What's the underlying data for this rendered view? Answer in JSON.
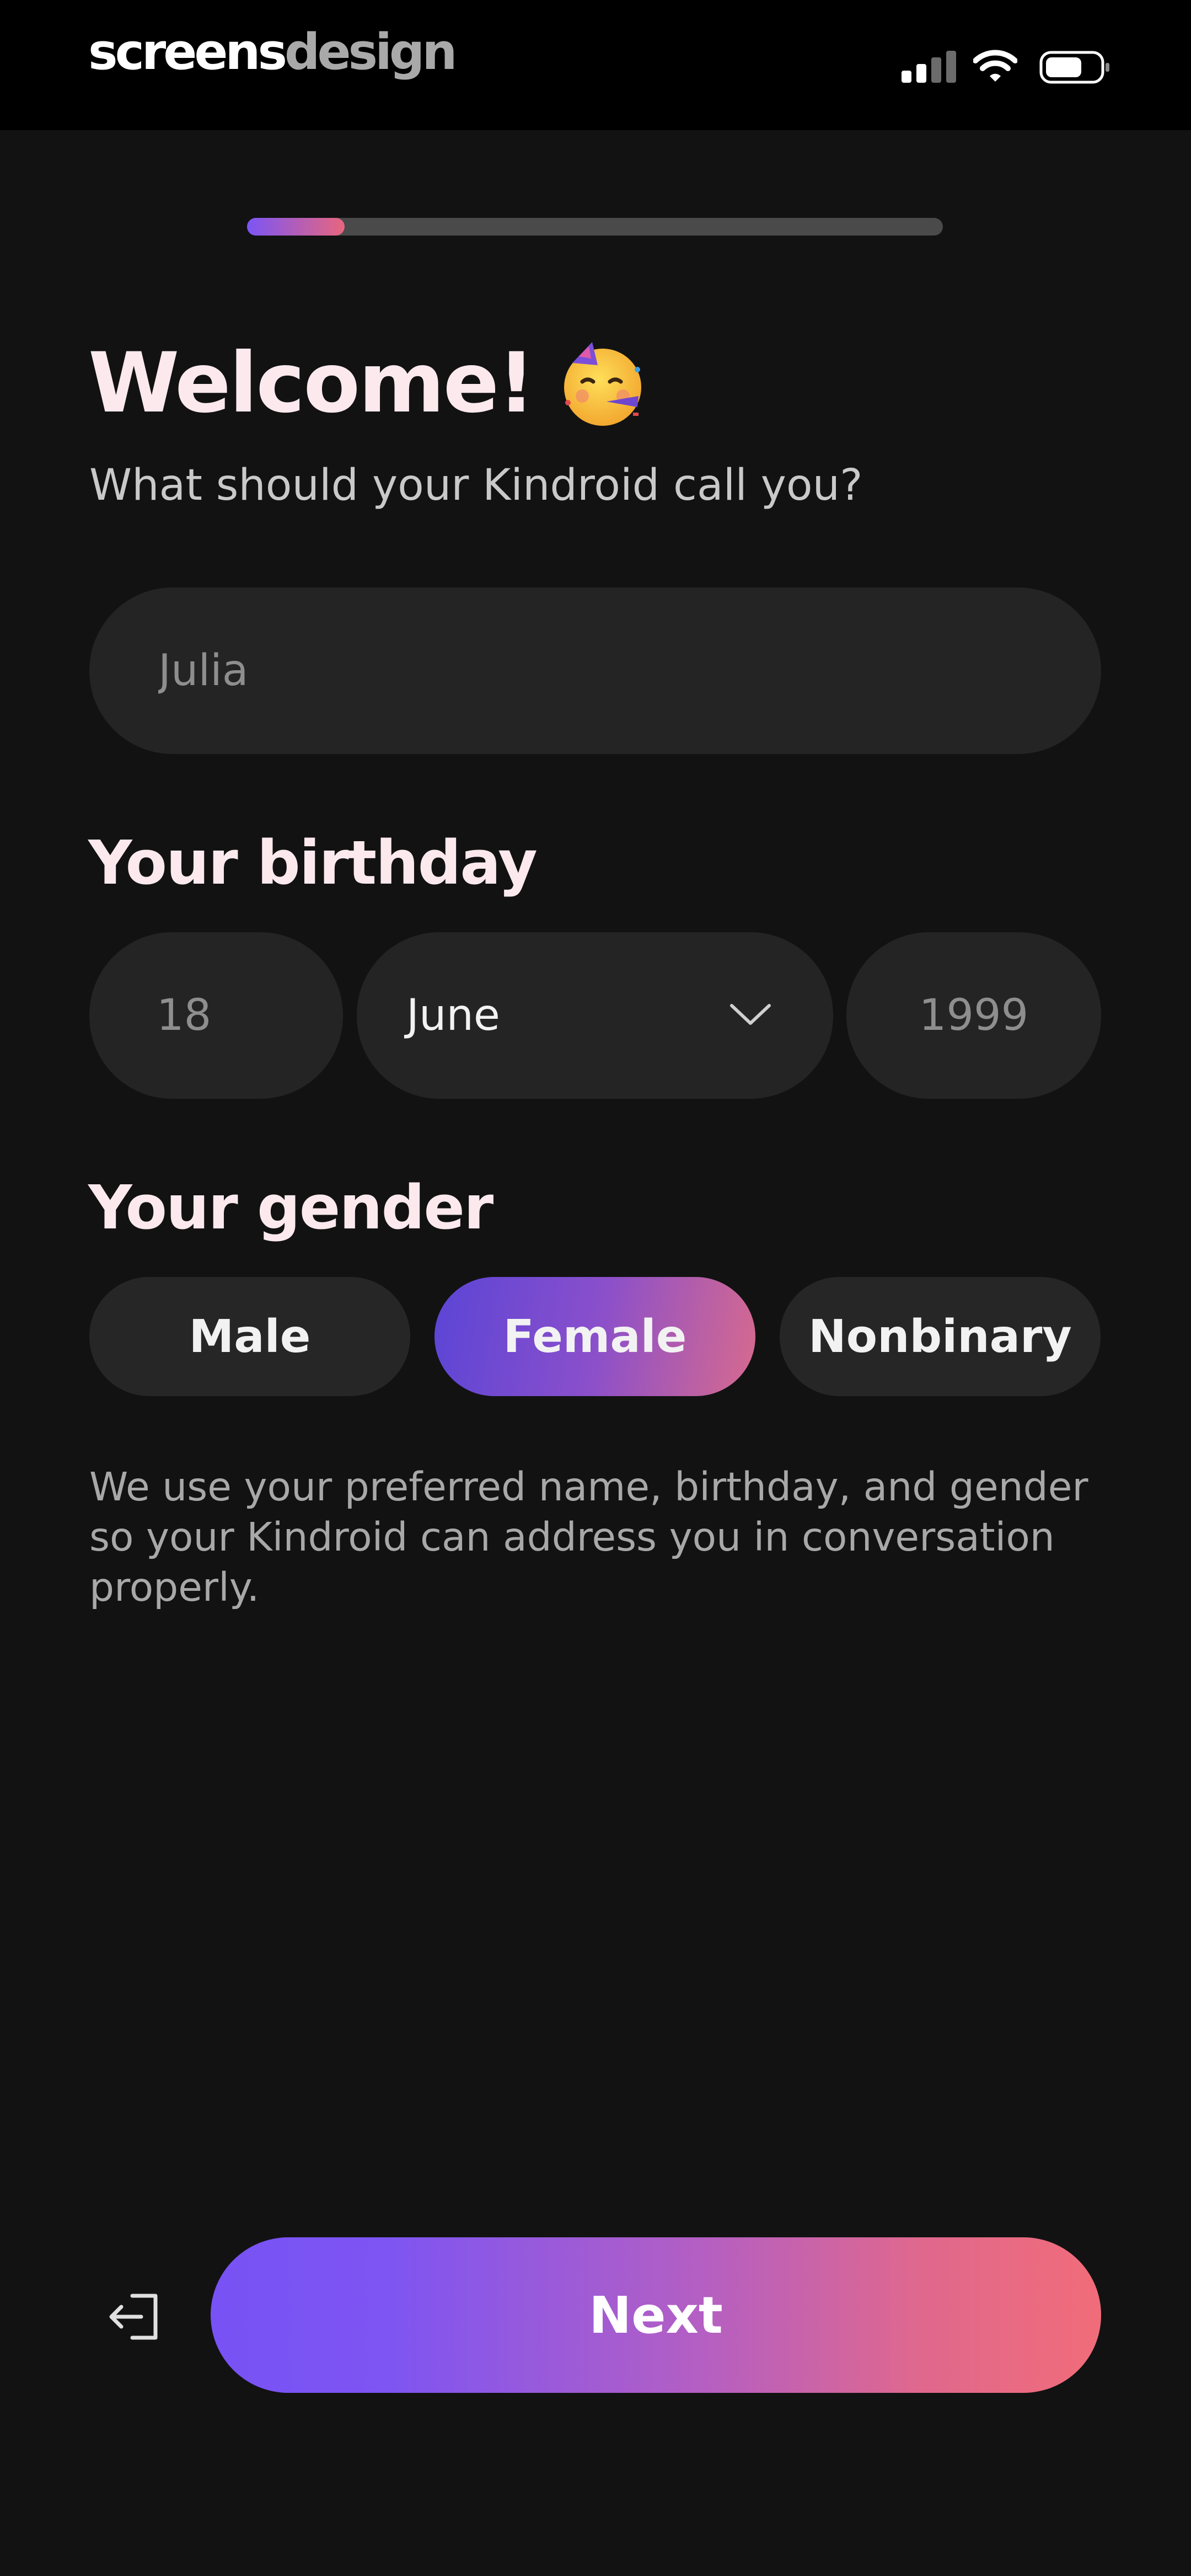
{
  "status_bar": {
    "brand_part1": "screens",
    "brand_part2": "design",
    "icons": [
      "cellular-signal-icon",
      "wifi-icon",
      "battery-icon"
    ]
  },
  "progress": {
    "fraction": 0.14
  },
  "welcome": {
    "title": "Welcome!",
    "emoji_icon": "partying-face-icon",
    "subtitle": "What should your Kindroid call you?"
  },
  "name_input": {
    "placeholder": "Julia",
    "value": ""
  },
  "birthday": {
    "title": "Your birthday",
    "day_placeholder": "18",
    "month_value": "June",
    "year_placeholder": "1999"
  },
  "gender": {
    "title": "Your gender",
    "options": [
      "Male",
      "Female",
      "Nonbinary"
    ],
    "selected": "Female"
  },
  "info_text": "We use your preferred name, birthday, and gender so your Kindroid can address you in conversation properly.",
  "footer": {
    "exit_icon": "logout-icon",
    "next_label": "Next"
  },
  "colors": {
    "background": "#121212",
    "field_bg": "#242424",
    "gradient_start": "#7852f5",
    "gradient_end": "#f16c79",
    "heading": "#fbe9ee"
  }
}
